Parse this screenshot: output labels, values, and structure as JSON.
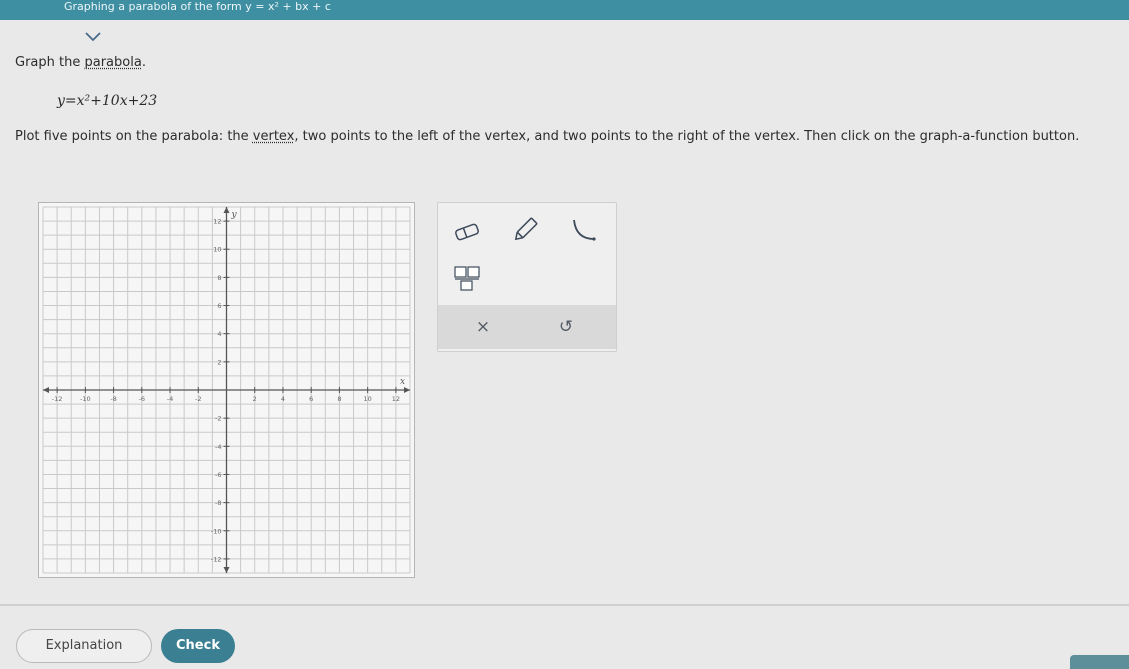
{
  "header": {
    "title": "Graphing a parabola of the form y = x² + bx + c"
  },
  "question": {
    "prompt_prefix": "Graph the ",
    "prompt_link": "parabola",
    "prompt_suffix": ".",
    "equation": "y=x²+10x+23",
    "instr_prefix": "Plot five points on the parabola: the ",
    "instr_link": "vertex",
    "instr_suffix": ", two points to the left of the vertex, and two points to the right of the vertex. Then click on the graph-a-function button."
  },
  "graph": {
    "x_range": [
      -13,
      13
    ],
    "y_range": [
      -13,
      13
    ],
    "grid": true,
    "x_axis_label": "x",
    "y_axis_label": "y",
    "x_tick_labels": [
      "-12",
      "-10",
      "-8",
      "-6",
      "-4",
      "-2",
      "2",
      "4",
      "6",
      "8",
      "10",
      "12"
    ],
    "x_tick_values": [
      -12,
      -10,
      -8,
      -6,
      -4,
      -2,
      2,
      4,
      6,
      8,
      10,
      12
    ],
    "y_tick_labels": [
      "12",
      "10",
      "8",
      "6",
      "4",
      "2",
      "-2",
      "-4",
      "-6",
      "-8",
      "-10",
      "-12"
    ],
    "y_tick_values": [
      12,
      10,
      8,
      6,
      4,
      2,
      -2,
      -4,
      -6,
      -8,
      -10,
      -12
    ]
  },
  "tools": {
    "items": [
      "eraser-tool",
      "pencil-tool",
      "parabola-tool",
      "fraction-tool"
    ],
    "clear_label": "×",
    "undo_label": "↺"
  },
  "footer": {
    "explanation_label": "Explanation",
    "check_label": "Check"
  },
  "colors": {
    "header": "#3f8fa3",
    "check_button": "#3b7f92"
  }
}
